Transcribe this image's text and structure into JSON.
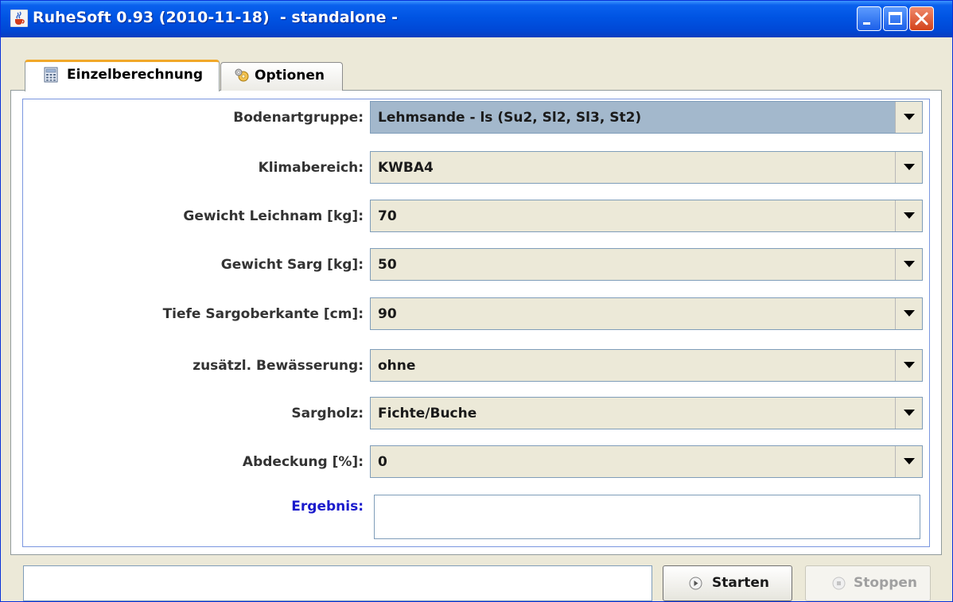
{
  "window": {
    "title": "RuheSoft 0.93 (2010-11-18)  - standalone -",
    "icons": {
      "app": "java-cup-icon",
      "minimize": "minimize-icon",
      "maximize": "maximize-icon",
      "close": "close-icon"
    }
  },
  "tabs": [
    {
      "label": "Einzelberechnung",
      "icon": "calculator-icon",
      "active": true
    },
    {
      "label": "Optionen",
      "icon": "gears-icon",
      "active": false
    }
  ],
  "form": {
    "fields": [
      {
        "label": "Bodenartgruppe:",
        "value": "Lehmsande - ls (Su2, Sl2, Sl3, St2)",
        "selected": true
      },
      {
        "label": "Klimabereich:",
        "value": "KWBA4"
      },
      {
        "label": "Gewicht Leichnam [kg]:",
        "value": "70"
      },
      {
        "label": "Gewicht Sarg [kg]:",
        "value": "50"
      },
      {
        "label": "Tiefe Sargoberkante [cm]:",
        "value": "90"
      },
      {
        "label": "zusätzl. Bewässerung:",
        "value": "ohne"
      },
      {
        "label": "Sargholz:",
        "value": "Fichte/Buche"
      },
      {
        "label": "Abdeckung [%]:",
        "value": "0"
      }
    ],
    "result_label": "Ergebnis:",
    "result_value": ""
  },
  "statusbar": {
    "status_text": "",
    "start_label": "Starten",
    "stop_label": "Stoppen",
    "stop_enabled": false
  },
  "colors": {
    "title_blue": "#0054e3",
    "ergebnis_label": "#1a1acc",
    "tab_highlight": "#f1a829",
    "selected_combo": "#a3b8cc"
  }
}
